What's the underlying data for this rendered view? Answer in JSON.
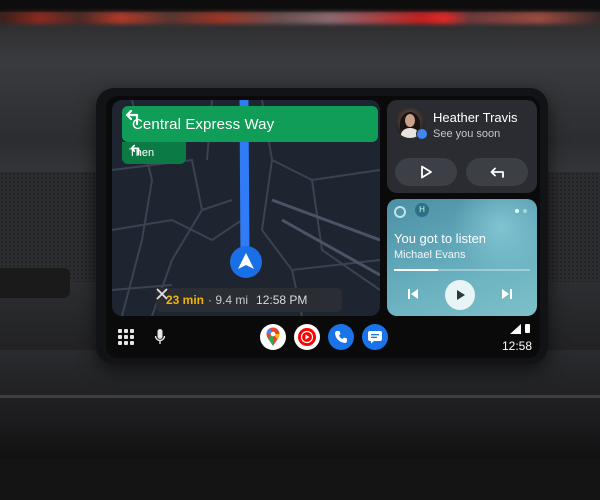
{
  "navigation": {
    "street": "Central Express Way",
    "then_label": "Then",
    "eta_minutes": "23 min",
    "eta_distance": "· 9.4 mi",
    "eta_arrival": "12:58 PM"
  },
  "message": {
    "contact_name": "Heather Travis",
    "text": "See you soon"
  },
  "media": {
    "title": "You got to listen",
    "artist": "Michael Evans",
    "progress_fraction": 0.32,
    "page_count": 2,
    "active_page": 1
  },
  "status_bar": {
    "time": "12:58"
  },
  "colors": {
    "nav_green": "#0f9d58",
    "eta_orange": "#f2b400",
    "route_blue": "#2f7cf6",
    "dock_blue": "#1a73e8"
  },
  "icons": {
    "turn": "turn-left-icon",
    "close": "close-icon",
    "play": "play-icon",
    "reply": "reply-icon",
    "prev": "skip-previous-icon",
    "next": "skip-next-icon",
    "apps": "app-grid-icon",
    "mic": "microphone-icon",
    "maps": "google-maps-icon",
    "music": "youtube-music-icon",
    "phone": "phone-icon",
    "messages": "messages-icon",
    "signal": "signal-icon",
    "battery": "battery-icon"
  }
}
